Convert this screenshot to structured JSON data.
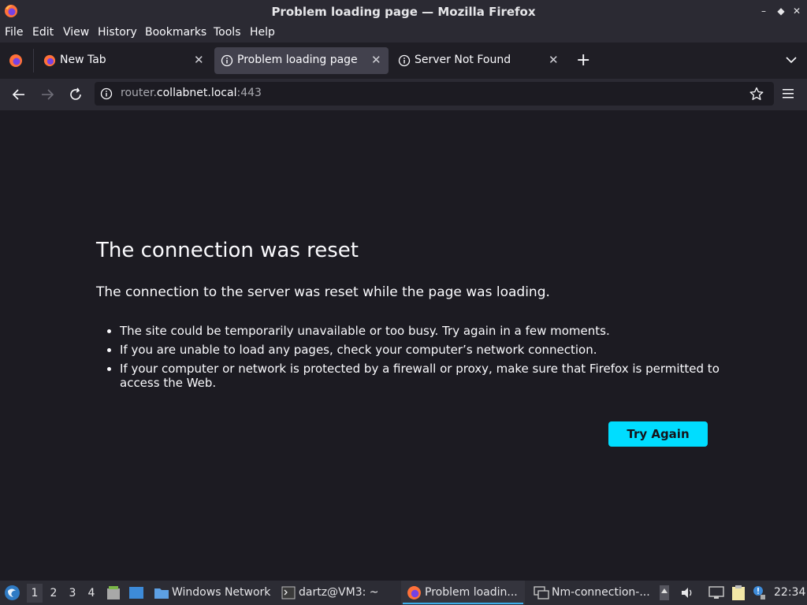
{
  "window": {
    "title": "Problem loading page — Mozilla Firefox",
    "controls": [
      "minimize-icon",
      "restore-icon",
      "close-icon"
    ]
  },
  "menu": [
    "File",
    "Edit",
    "View",
    "History",
    "Bookmarks",
    "Tools",
    "Help"
  ],
  "tabs": [
    {
      "label": "New Tab",
      "icon": "firefox-icon"
    },
    {
      "label": "Problem loading page",
      "icon": "info-icon",
      "active": true
    },
    {
      "label": "Server Not Found",
      "icon": "info-icon"
    }
  ],
  "nav": {
    "url_prefix": "router.",
    "url_host": "collabnet.local",
    "url_port": ":443"
  },
  "error": {
    "title": "The connection was reset",
    "description": "The connection to the server was reset while the page was loading.",
    "suggestions": [
      "The site could be temporarily unavailable or too busy. Try again in a few moments.",
      "If you are unable to load any pages, check your computer’s network connection.",
      "If your computer or network is protected by a firewall or proxy, make sure that Firefox is permitted to access the Web."
    ],
    "button": "Try Again"
  },
  "taskbar": {
    "workspaces": [
      "1",
      "2",
      "3",
      "4"
    ],
    "tasks": [
      {
        "label": "Windows Network",
        "icon": "folder-icon"
      },
      {
        "label": "dartz@VM3: ~",
        "icon": "terminal-icon"
      },
      {
        "label": "Problem loadin...",
        "icon": "firefox-icon",
        "active": true
      },
      {
        "label": "Nm-connection-...",
        "icon": "network-icon"
      }
    ],
    "clock": "22:34"
  },
  "colors": {
    "accent": "#00ddff",
    "taskbar_highlight": "#3daee9"
  }
}
